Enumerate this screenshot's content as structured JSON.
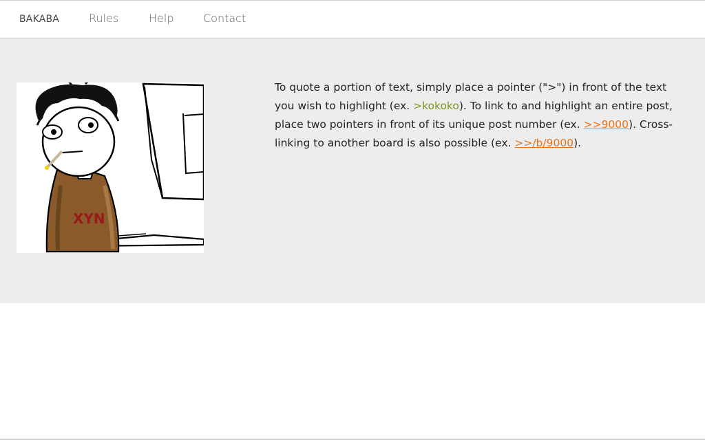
{
  "nav": {
    "brand": "BAKABA",
    "links": [
      {
        "label": "Rules"
      },
      {
        "label": "Help"
      },
      {
        "label": "Contact"
      }
    ]
  },
  "hero": {
    "illustration_icon": "computer-guy-drawing-icon",
    "illustration_text": "XYN",
    "text_1": "To quote a portion of text, simply place a pointer (\">\") in front of the text you wish to highlight (ex. ",
    "greentext_example": ">kokoko",
    "text_2": "). To link to and highlight an entire post, place two pointers in front of its unique post number (ex. ",
    "post_link_example": ">>9000",
    "text_3": "). Cross-linking to another board is also possible (ex. ",
    "board_link_example": ">>/b/9000",
    "text_4": ")."
  },
  "colors": {
    "greentext": "#789922",
    "link": "#e8731d",
    "hero_bg": "#ededed"
  }
}
